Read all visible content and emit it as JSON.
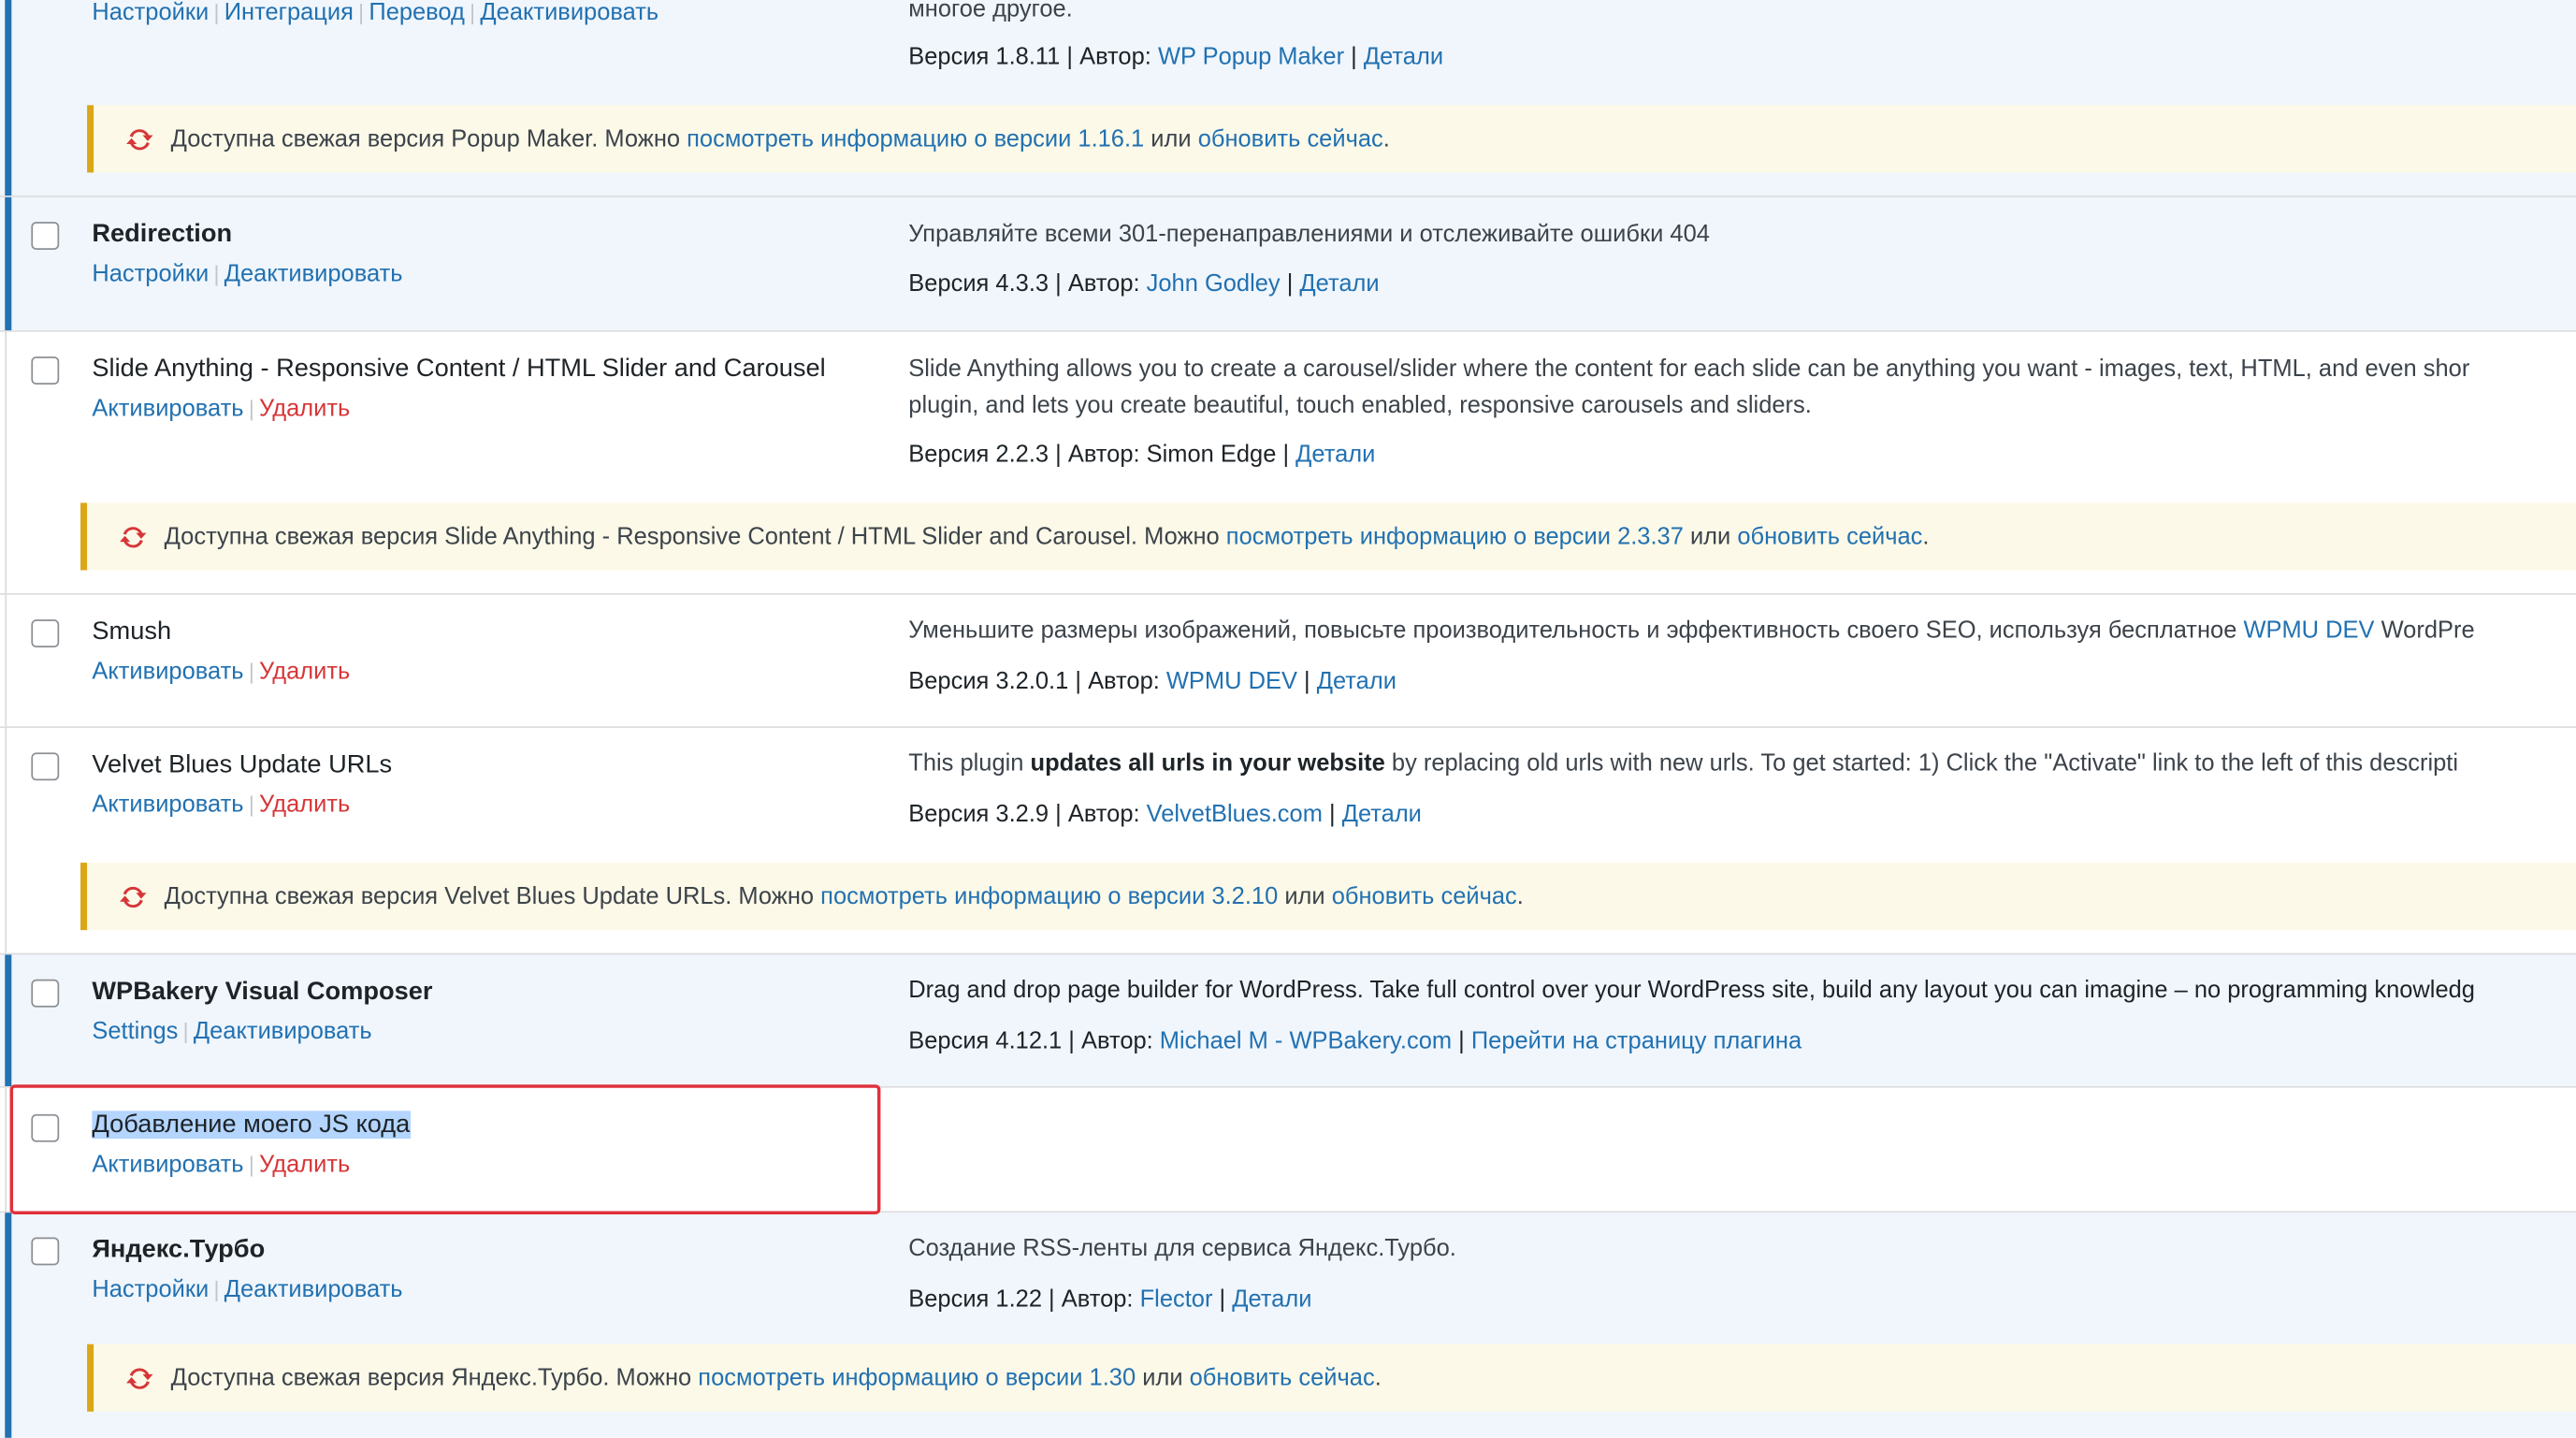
{
  "accent_color": "#2271b1",
  "delete_color": "#d63638",
  "notice_border_color": "#dba617",
  "highlight_box_color": "#e0323c",
  "popup_maker": {
    "actions": [
      "Настройки",
      "Интеграция",
      "Перевод",
      "Деактивировать"
    ],
    "desc_tail": "многое другое.",
    "version_label": "Версия 1.8.11 | Автор:",
    "author": "WP Popup Maker",
    "details": "Детали",
    "notice": {
      "icon": "update-icon",
      "text_before": "Доступна свежая версия Popup Maker. Можно",
      "view_link": "посмотреть информацию о версии 1.16.1",
      "or": "или",
      "update_link": "обновить сейчас",
      "end": "."
    }
  },
  "redirection": {
    "name": "Redirection",
    "actions": [
      "Настройки",
      "Деактивировать"
    ],
    "description": "Управляйте всеми 301-перенаправлениями и отслеживайте ошибки 404",
    "version_label": "Версия 4.3.3 | Автор:",
    "author": "John Godley",
    "details": "Детали"
  },
  "slide_anything": {
    "name": "Slide Anything - Responsive Content / HTML Slider and Carousel",
    "actions": [
      "Активировать",
      "Удалить"
    ],
    "description_line1": "Slide Anything allows you to create a carousel/slider where the content for each slide can be anything you want - images, text, HTML, and even shor",
    "description_line2": "plugin, and lets you create beautiful, touch enabled, responsive carousels and sliders.",
    "version_label": "Версия 2.2.3 | Автор: Simon Edge |",
    "details": "Детали",
    "notice": {
      "icon": "update-icon",
      "text_before": "Доступна свежая версия Slide Anything - Responsive Content / HTML Slider and Carousel. Можно",
      "view_link": "посмотреть информацию о версии 2.3.37",
      "or": "или",
      "update_link": "обновить сейчас",
      "end": "."
    }
  },
  "smush": {
    "name": "Smush",
    "actions": [
      "Активировать",
      "Удалить"
    ],
    "description_before": "Уменьшите размеры изображений, повысьте производительность и эффективность своего SEO, используя бесплатное",
    "description_link": "WPMU DEV",
    "description_after": "WordPre",
    "version_label": "Версия 3.2.0.1 | Автор:",
    "author": "WPMU DEV",
    "details": "Детали"
  },
  "velvet_blues": {
    "name": "Velvet Blues Update URLs",
    "actions": [
      "Активировать",
      "Удалить"
    ],
    "description_before": "This plugin",
    "description_bold": "updates all urls in your website",
    "description_after": "by replacing old urls with new urls. To get started: 1) Click the \"Activate\" link to the left of this descripti",
    "version_label": "Версия 3.2.9 | Автор:",
    "author": "VelvetBlues.com",
    "details": "Детали",
    "notice": {
      "icon": "update-icon",
      "text_before": "Доступна свежая версия Velvet Blues Update URLs. Можно",
      "view_link": "посмотреть информацию о версии 3.2.10",
      "or": "или",
      "update_link": "обновить сейчас",
      "end": "."
    }
  },
  "wpbakery": {
    "name": "WPBakery Visual Composer",
    "actions": [
      "Settings",
      "Деактивировать"
    ],
    "description": "Drag and drop page builder for WordPress. Take full control over your WordPress site, build any layout you can imagine – no programming knowledg",
    "version_label": "Версия 4.12.1 | Автор:",
    "author": "Michael M - WPBakery.com",
    "plugin_page": "Перейти на страницу плагина"
  },
  "my_js": {
    "name": "Добавление моего JS кода",
    "actions": [
      "Активировать",
      "Удалить"
    ]
  },
  "yandex_turbo": {
    "name": "Яндекс.Турбо",
    "actions": [
      "Настройки",
      "Деактивировать"
    ],
    "description": "Создание RSS-ленты для сервиса Яндекс.Турбо.",
    "version_label": "Версия 1.22 | Автор:",
    "author": "Flector",
    "details": "Детали",
    "notice": {
      "icon": "update-icon",
      "text_before": "Доступна свежая версия Яндекс.Турбо. Можно",
      "view_link": "посмотреть информацию о версии 1.30",
      "or": "или",
      "update_link": "обновить сейчас",
      "end": "."
    }
  }
}
